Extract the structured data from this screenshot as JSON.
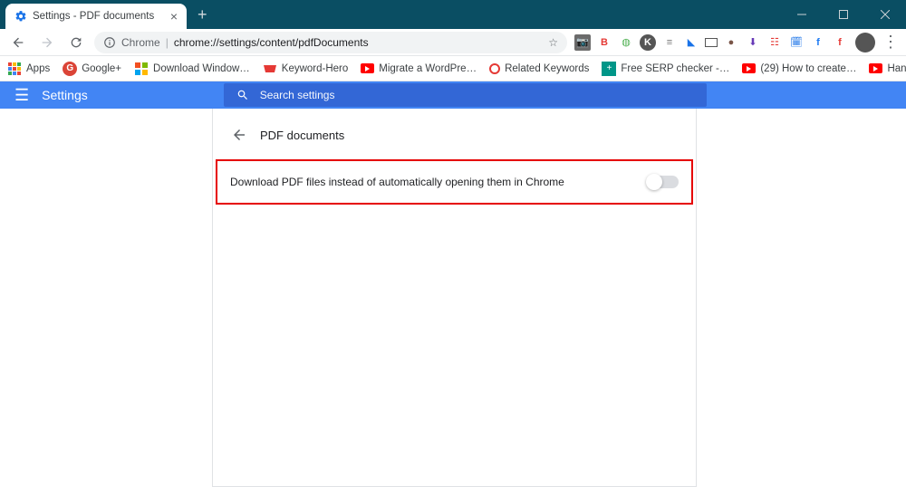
{
  "titlebar": {
    "tab_title": "Settings - PDF documents",
    "tab_close": "×",
    "new_tab": "+"
  },
  "address": {
    "scheme": "Chrome",
    "url": "chrome://settings/content/pdfDocuments",
    "star": "☆"
  },
  "bookmarks": {
    "apps": "Apps",
    "items": [
      {
        "label": "Google+"
      },
      {
        "label": "Download Window…"
      },
      {
        "label": "Keyword-Hero"
      },
      {
        "label": "Migrate a WordPre…"
      },
      {
        "label": "Related Keywords"
      },
      {
        "label": "Free SERP checker -…"
      },
      {
        "label": "(29) How to create…"
      },
      {
        "label": "Hang Ups (Want Yo…"
      }
    ],
    "more": "»"
  },
  "app": {
    "title": "Settings",
    "search_placeholder": "Search settings"
  },
  "page": {
    "heading": "PDF documents",
    "option_label": "Download PDF files instead of automatically opening them in Chrome"
  }
}
